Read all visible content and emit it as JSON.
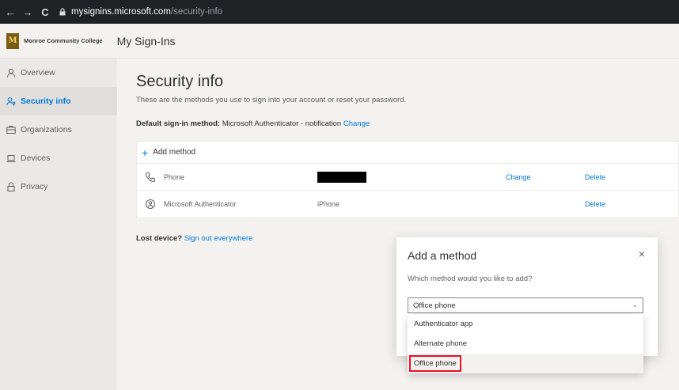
{
  "browser": {
    "back": "←",
    "forward": "→",
    "reload": "C",
    "url_host": "mysignins.microsoft.com",
    "url_path": "/security-info"
  },
  "header": {
    "org_logo_text": "Monroe Community College",
    "app_title": "My Sign-Ins"
  },
  "sidebar": {
    "items": [
      {
        "label": "Overview",
        "icon": "person-icon"
      },
      {
        "label": "Security info",
        "icon": "security-info-icon"
      },
      {
        "label": "Organizations",
        "icon": "briefcase-icon"
      },
      {
        "label": "Devices",
        "icon": "laptop-icon"
      },
      {
        "label": "Privacy",
        "icon": "lock-icon"
      }
    ],
    "active_index": 1
  },
  "main": {
    "title": "Security info",
    "description": "These are the methods you use to sign into your account or reset your password.",
    "default_label": "Default sign-in method:",
    "default_value": "Microsoft Authenticator - notification",
    "default_change": "Change",
    "add_method": "Add method",
    "methods": [
      {
        "icon": "phone-icon",
        "name": "Phone",
        "detail": "",
        "change": "Change",
        "delete": "Delete"
      },
      {
        "icon": "authenticator-icon",
        "name": "Microsoft Authenticator",
        "detail": "iPhone",
        "change": "",
        "delete": "Delete"
      }
    ],
    "lost_label": "Lost device?",
    "lost_link": "Sign out everywhere"
  },
  "modal": {
    "title": "Add a method",
    "close": "×",
    "question": "Which method would you like to add?",
    "selected": "Office phone",
    "options": [
      "Authenticator app",
      "Alternate phone",
      "Office phone"
    ],
    "highlighted_index": 2
  },
  "colors": {
    "accent": "#0078d4",
    "highlight_box": "#e81123"
  }
}
